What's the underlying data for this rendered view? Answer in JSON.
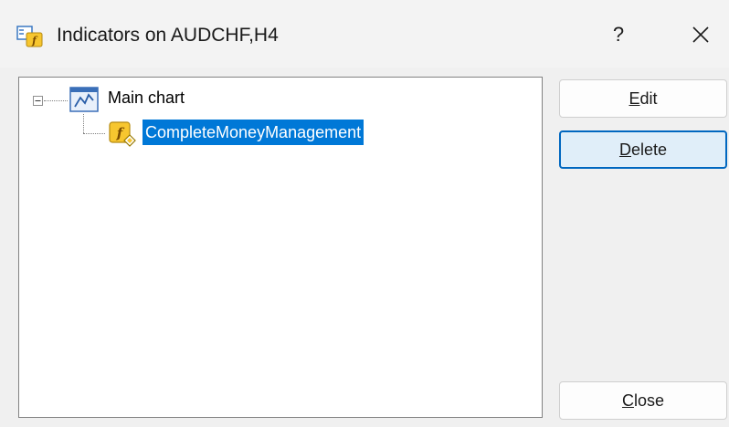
{
  "window": {
    "title": "Indicators on AUDCHF,H4",
    "help_label": "?",
    "close_icon": "close-icon"
  },
  "tree": {
    "root": {
      "label": "Main chart",
      "icon": "chart-icon",
      "expanded": true,
      "children": [
        {
          "label": "CompleteMoneyManagement",
          "icon": "custom-indicator-icon",
          "selected": true
        }
      ]
    }
  },
  "buttons": {
    "edit": {
      "accel": "E",
      "rest": "dit"
    },
    "delete": {
      "accel": "D",
      "rest": "elete"
    },
    "close": {
      "accel": "C",
      "rest": "lose"
    }
  },
  "colors": {
    "selection": "#0078d7",
    "focus_border": "#0067c0",
    "window_bg": "#f0f0f0"
  }
}
